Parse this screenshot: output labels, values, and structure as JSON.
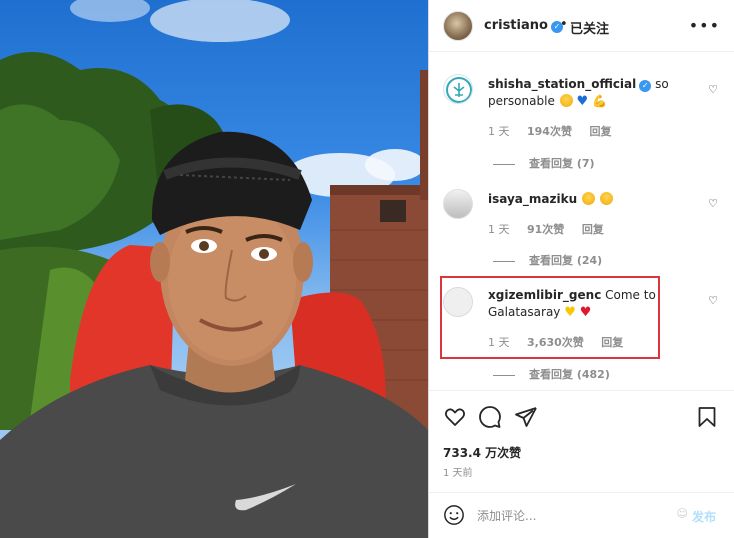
{
  "post": {
    "username": "cristiano",
    "follow_state": "已关注",
    "likes": "733.4 万次赞",
    "time": "1 天前"
  },
  "comments": [
    {
      "username": "shisha_station_official",
      "verified": true,
      "text_line1": "so",
      "text_line2": "personable",
      "emojis": [
        "😄",
        "💙",
        "💪"
      ],
      "age": "1 天",
      "likes": "194次赞",
      "reply": "回复",
      "view_replies": "查看回复 (7)"
    },
    {
      "username": "isaya_maziku",
      "verified": false,
      "text": "",
      "emojis": [
        "😂",
        "😂"
      ],
      "age": "1 天",
      "likes": "91次赞",
      "reply": "回复",
      "view_replies": "查看回复 (24)"
    },
    {
      "username": "xgizemlibir_genc",
      "verified": false,
      "text_line1": "Come to",
      "text_line2": "Galatasaray",
      "emojis": [
        "💛",
        "❤️"
      ],
      "age": "1 天",
      "likes": "3,630次赞",
      "reply": "回复",
      "view_replies": "查看回复 (482)"
    }
  ],
  "compose": {
    "placeholder": "添加评论...",
    "post_label": "发布"
  },
  "icons": {
    "more": "more-horizontal-icon",
    "like": "heart-icon",
    "comment": "comment-icon",
    "share": "share-icon",
    "save": "bookmark-icon",
    "emoji": "emoji-icon"
  },
  "colors": {
    "link_blue": "#3897f0",
    "highlight": "#d9363e",
    "post_disabled": "#b2dffc"
  }
}
